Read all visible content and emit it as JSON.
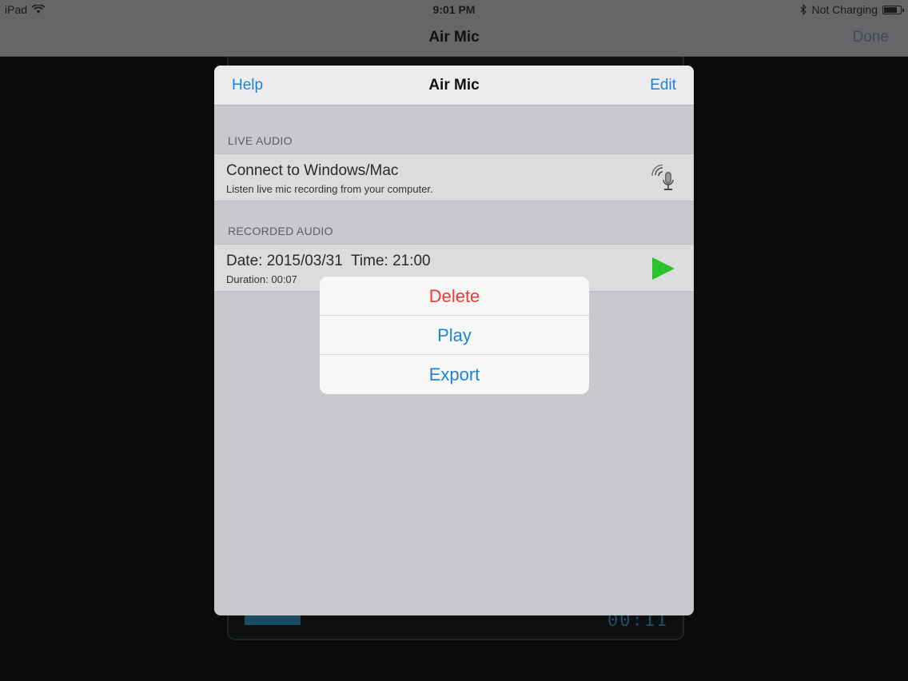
{
  "status_bar": {
    "device": "iPad",
    "time": "9:01 PM",
    "charging": "Not Charging"
  },
  "nav_bar": {
    "title": "Air Mic",
    "done_label": "Done"
  },
  "panel": {
    "help_label": "Help",
    "title": "Air Mic",
    "edit_label": "Edit",
    "sections": [
      {
        "header": "LIVE AUDIO",
        "rows": [
          {
            "title": "Connect to Windows/Mac",
            "subtitle": "Listen live mic recording from your computer.",
            "icon": "wireless-mic-icon"
          }
        ]
      },
      {
        "header": "RECORDED AUDIO",
        "rows": [
          {
            "title": "Date: 2015/03/31  Time: 21:00",
            "subtitle": "Duration: 00:07",
            "icon": "play-icon"
          }
        ]
      }
    ]
  },
  "action_sheet": {
    "actions": [
      {
        "label": "Delete",
        "style": "destructive"
      },
      {
        "label": "Play",
        "style": "normal"
      },
      {
        "label": "Export",
        "style": "normal"
      }
    ]
  },
  "background": {
    "timer_display": "00:11"
  },
  "colors": {
    "accent": "#1f82d6",
    "destructive": "#ee3b33",
    "play": "#2bc52b"
  }
}
